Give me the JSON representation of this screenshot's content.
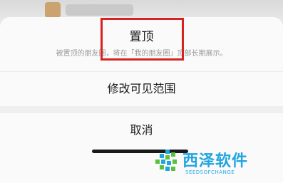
{
  "sheet": {
    "pin_title": "置顶",
    "pin_description": "被置顶的朋友圈，将在「我的朋友圈」顶部长期展示。",
    "edit_visibility": "修改可见范围",
    "cancel": "取消"
  },
  "watermark": {
    "title": "西泽软件",
    "subtitle": "SEEDSOFCHANGE"
  },
  "colors": {
    "highlight": "#d72222",
    "watermark": "#21a5e0"
  }
}
